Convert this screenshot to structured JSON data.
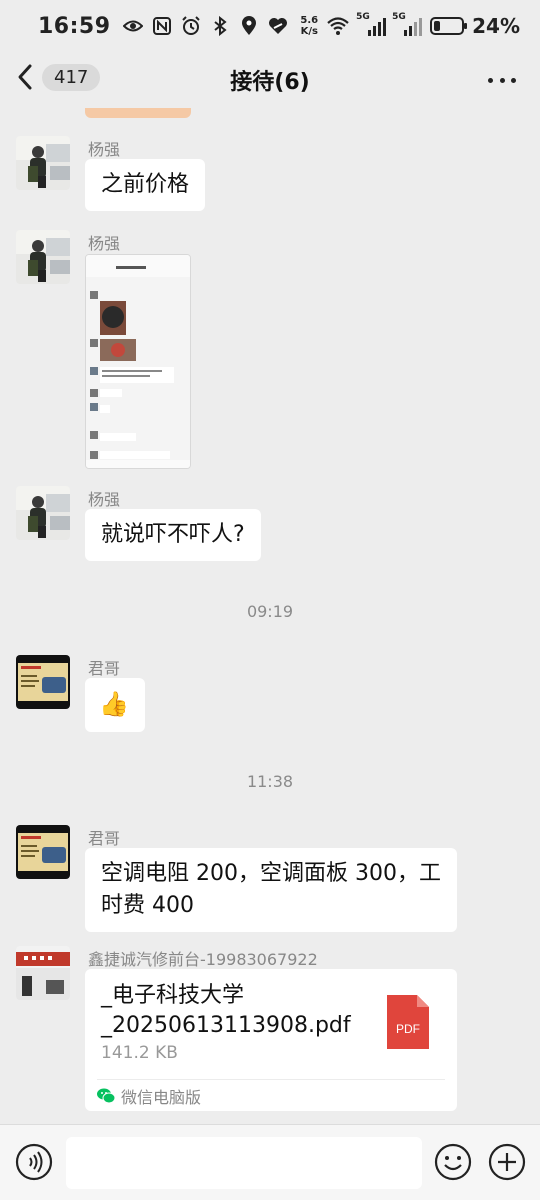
{
  "status_bar": {
    "time": "16:59",
    "net_speed_value": "5.6",
    "net_speed_unit": "K/s",
    "signal1_label": "5G",
    "signal2_label": "5G",
    "battery_percent": "24%",
    "battery_level": 0.24
  },
  "header": {
    "unread_count": "417",
    "title": "接待(6)"
  },
  "messages": [
    {
      "sender": "杨强",
      "text": "之前价格"
    },
    {
      "sender": "杨强",
      "type": "image"
    },
    {
      "sender": "杨强",
      "text": "就说吓不吓人?"
    },
    {
      "timestamp": "09:19"
    },
    {
      "sender": "君哥",
      "emoji": "👍"
    },
    {
      "timestamp": "11:38"
    },
    {
      "sender": "君哥",
      "text": "空调电阻 200，空调面板 300，工时费 400"
    },
    {
      "sender": "鑫捷诚汽修前台-19983067922",
      "file_name": "_电子科技大学_20250613113908.pdf",
      "file_size": "141.2 KB",
      "file_type": "PDF",
      "source": "微信电脑版"
    }
  ],
  "colors": {
    "background": "#ededed",
    "bubble": "#ffffff",
    "pdf_red": "#e0453c",
    "wechat_green": "#07c160"
  }
}
